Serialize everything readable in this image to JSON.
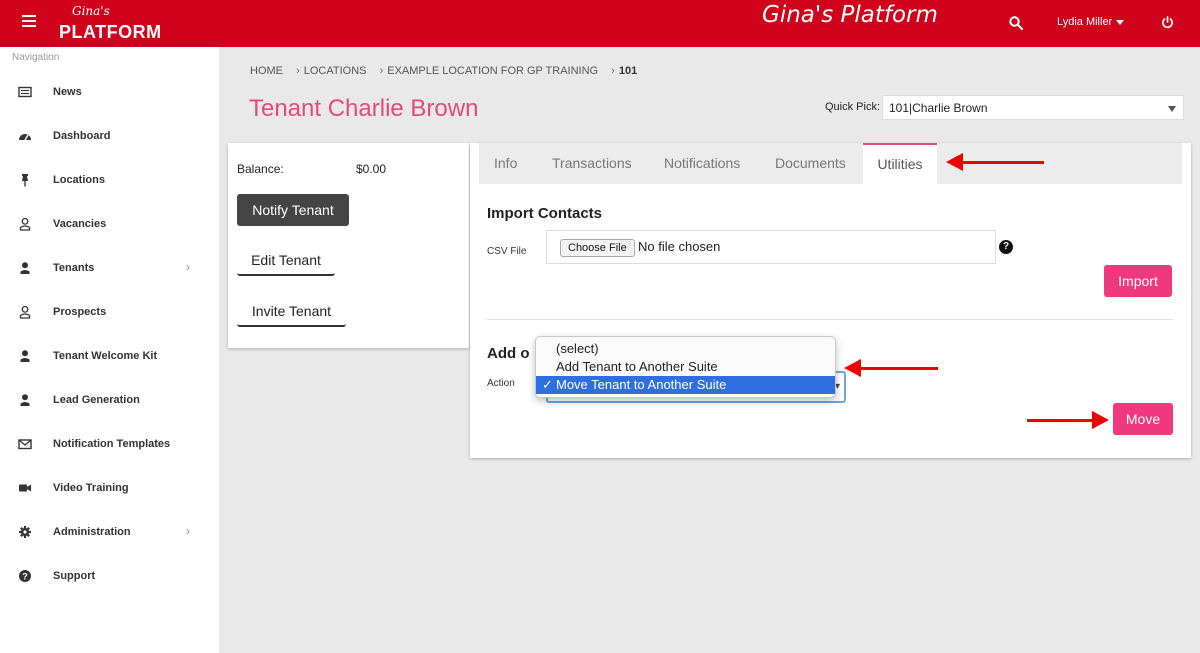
{
  "app": {
    "logo_script": "Gina's",
    "logo_main": "PLATFORM",
    "platform_title": "Gina's Platform",
    "user_name": "Lydia Miller",
    "accent_color": "#d0021b",
    "pink_color": "#f0387c"
  },
  "sidebar": {
    "nav_label": "Navigation",
    "items": [
      {
        "label": "News",
        "icon": "newspaper-icon"
      },
      {
        "label": "Dashboard",
        "icon": "dashboard-icon"
      },
      {
        "label": "Locations",
        "icon": "pushpin-icon"
      },
      {
        "label": "Vacancies",
        "icon": "user-outline-icon"
      },
      {
        "label": "Tenants",
        "icon": "user-icon",
        "has_children": true
      },
      {
        "label": "Prospects",
        "icon": "user-outline-icon"
      },
      {
        "label": "Tenant Welcome Kit",
        "icon": "user-icon"
      },
      {
        "label": "Lead Generation",
        "icon": "user-icon"
      },
      {
        "label": "Notification Templates",
        "icon": "envelope-icon"
      },
      {
        "label": "Video Training",
        "icon": "video-camera-icon"
      },
      {
        "label": "Administration",
        "icon": "gear-icon",
        "has_children": true
      },
      {
        "label": "Support",
        "icon": "question-circle-icon"
      }
    ]
  },
  "breadcrumb": {
    "home": "HOME",
    "locations": "LOCATIONS",
    "location": "EXAMPLE LOCATION FOR GP TRAINING",
    "current": "101"
  },
  "page": {
    "title": "Tenant Charlie Brown",
    "quick_pick_label": "Quick Pick:",
    "quick_pick_value": "101|Charlie Brown"
  },
  "tenant_card": {
    "balance_label": "Balance:",
    "balance_value": "$0.00",
    "notify_button": "Notify Tenant",
    "edit_button": "Edit Tenant",
    "invite_button": "Invite Tenant"
  },
  "tabs": [
    {
      "label": "Info"
    },
    {
      "label": "Transactions"
    },
    {
      "label": "Notifications"
    },
    {
      "label": "Documents"
    },
    {
      "label": "Utilities",
      "active": true
    }
  ],
  "import_contacts": {
    "title": "Import Contacts",
    "csv_label": "CSV File",
    "choose_file": "Choose File",
    "no_file": "No file chosen",
    "import_button": "Import"
  },
  "add_or_move": {
    "title_visible": "Add o",
    "action_label": "Action",
    "options": [
      "(select)",
      "Add Tenant to Another Suite",
      "Move Tenant to Another Suite"
    ],
    "selected": "Move Tenant to Another Suite",
    "check_mark": "✓",
    "move_button": "Move"
  }
}
